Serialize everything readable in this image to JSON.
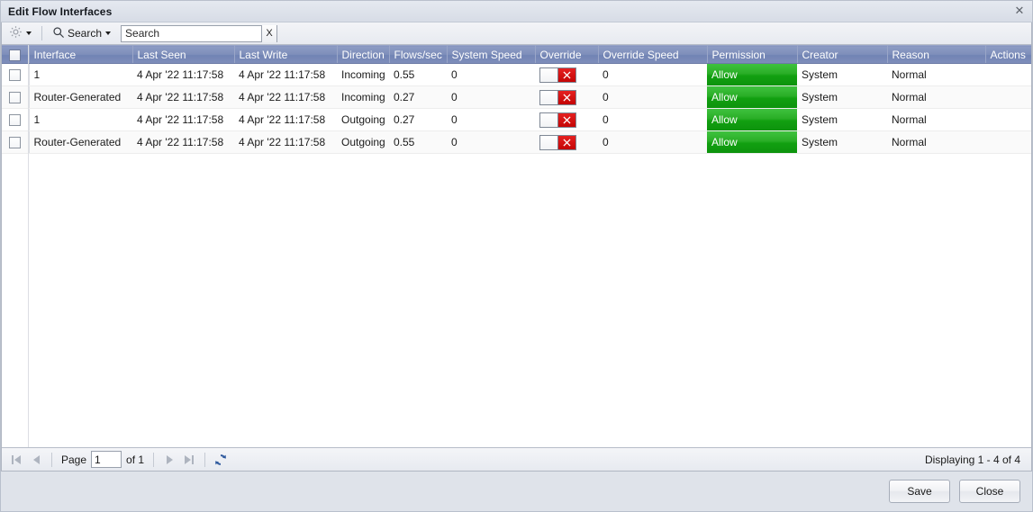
{
  "window": {
    "title": "Edit Flow Interfaces",
    "close_icon": "close-icon",
    "close_glyph": "✕"
  },
  "toolbar": {
    "gear_icon": "gear-icon",
    "search_icon": "search-icon",
    "search_menu_label": "Search",
    "search_placeholder": "Search",
    "search_value": "",
    "clear_label": "X"
  },
  "grid": {
    "columns": [
      {
        "key": "select",
        "label": "",
        "width": 30
      },
      {
        "key": "interface",
        "label": "Interface",
        "width": 115
      },
      {
        "key": "last_seen",
        "label": "Last Seen",
        "width": 113
      },
      {
        "key": "last_write",
        "label": "Last Write",
        "width": 114
      },
      {
        "key": "direction",
        "label": "Direction",
        "width": 58
      },
      {
        "key": "flows_sec",
        "label": "Flows/sec",
        "width": 64
      },
      {
        "key": "system_speed",
        "label": "System Speed",
        "width": 98
      },
      {
        "key": "override",
        "label": "Override",
        "width": 70
      },
      {
        "key": "override_speed",
        "label": "Override Speed",
        "width": 121
      },
      {
        "key": "permission",
        "label": "Permission",
        "width": 100
      },
      {
        "key": "creator",
        "label": "Creator",
        "width": 100
      },
      {
        "key": "reason",
        "label": "Reason",
        "width": 109
      },
      {
        "key": "actions",
        "label": "Actions",
        "width": 53
      }
    ],
    "rows": [
      {
        "interface": "1",
        "last_seen": "4 Apr '22 11:17:58",
        "last_write": "4 Apr '22 11:17:58",
        "direction": "Incoming",
        "flows_sec": "0.55",
        "system_speed": "0",
        "override": "off",
        "override_speed": "0",
        "permission": "Allow",
        "creator": "System",
        "reason": "Normal",
        "actions": ""
      },
      {
        "interface": "Router-Generated",
        "last_seen": "4 Apr '22 11:17:58",
        "last_write": "4 Apr '22 11:17:58",
        "direction": "Incoming",
        "flows_sec": "0.27",
        "system_speed": "0",
        "override": "off",
        "override_speed": "0",
        "permission": "Allow",
        "creator": "System",
        "reason": "Normal",
        "actions": ""
      },
      {
        "interface": "1",
        "last_seen": "4 Apr '22 11:17:58",
        "last_write": "4 Apr '22 11:17:58",
        "direction": "Outgoing",
        "flows_sec": "0.27",
        "system_speed": "0",
        "override": "off",
        "override_speed": "0",
        "permission": "Allow",
        "creator": "System",
        "reason": "Normal",
        "actions": ""
      },
      {
        "interface": "Router-Generated",
        "last_seen": "4 Apr '22 11:17:58",
        "last_write": "4 Apr '22 11:17:58",
        "direction": "Outgoing",
        "flows_sec": "0.55",
        "system_speed": "0",
        "override": "off",
        "override_speed": "0",
        "permission": "Allow",
        "creator": "System",
        "reason": "Normal",
        "actions": ""
      }
    ]
  },
  "pager": {
    "first_icon": "first-page-icon",
    "prev_icon": "previous-page-icon",
    "page_label": "Page",
    "page_value": "1",
    "of_label": "of 1",
    "next_icon": "next-page-icon",
    "last_icon": "last-page-icon",
    "refresh_icon": "refresh-icon",
    "display_text": "Displaying 1 - 4 of 4"
  },
  "footer": {
    "save_label": "Save",
    "close_label": "Close"
  },
  "colors": {
    "header_blue": "#7e8eba",
    "permission_green": "#1aa81a",
    "override_red": "#d01010",
    "window_chrome": "#dfe3ea"
  }
}
